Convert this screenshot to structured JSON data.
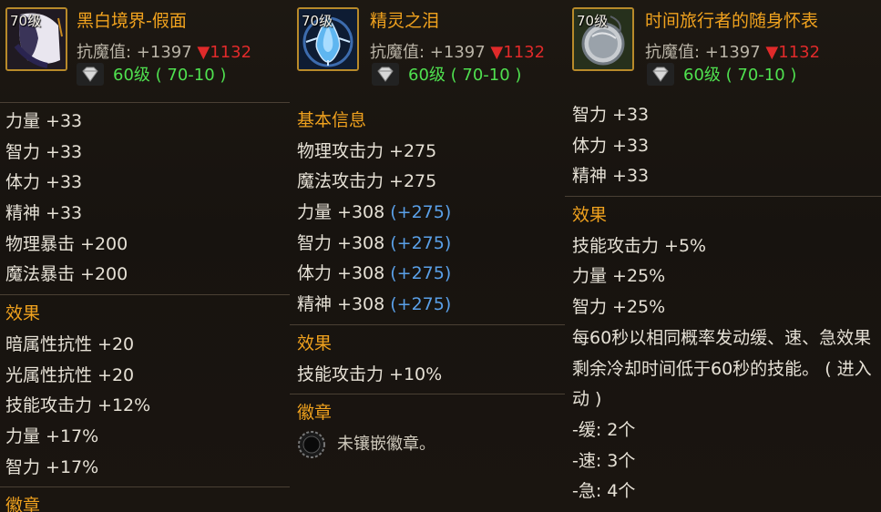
{
  "items": [
    {
      "level_badge": "70级",
      "name": "黑白境界-假面",
      "resist_label": "抗魔值: +1397 ",
      "resist_down": "▼1132",
      "requirement": "60级 ( 70-10 )",
      "stats": [
        "力量 +33",
        "智力 +33",
        "体力 +33",
        "精神 +33",
        "物理暴击 +200",
        "魔法暴击 +200"
      ],
      "effect_title": "效果",
      "effects": [
        "暗属性抗性 +20",
        "光属性抗性 +20",
        "技能攻击力 +12%",
        "力量 +17%",
        "智力 +17%"
      ],
      "cut_title": "徽章"
    },
    {
      "level_badge": "70级",
      "name": "精灵之泪",
      "resist_label": "抗魔值: +1397 ",
      "resist_down": "▼1132",
      "requirement": "60级 ( 70-10 )",
      "basic_title": "基本信息",
      "basic": [
        "物理攻击力 +275",
        "魔法攻击力 +275"
      ],
      "stats_main": [
        "力量 +308 ",
        "智力 +308 ",
        "体力 +308 ",
        "精神 +308 "
      ],
      "stats_bonus": [
        "(+275)",
        "(+275)",
        "(+275)",
        "(+275)"
      ],
      "effect_title": "效果",
      "effects": [
        "技能攻击力 +10%"
      ],
      "badge_title": "徽章",
      "badge_text": "未镶嵌徽章。"
    },
    {
      "level_badge": "70级",
      "name": "时间旅行者的随身怀表",
      "resist_label": "抗魔值: +1397 ",
      "resist_down": "▼1132",
      "requirement": "60级 ( 70-10 )",
      "stats": [
        "智力 +33",
        "体力 +33",
        "精神 +33"
      ],
      "effect_title": "效果",
      "effects": [
        "技能攻击力 +5%",
        "力量 +25%",
        "智力 +25%"
      ],
      "desc_lines": [
        "每60秒以相同概率发动缓、速、急效果",
        "剩余冷却时间低于60秒的技能。 ( 进入",
        "动 )"
      ],
      "counts": [
        "-缓: 2个",
        "-速: 3个",
        "-急: 4个"
      ]
    }
  ],
  "colors": {
    "title": "#f0a21e",
    "requirement": "#4fe04f",
    "down": "#e02a2a",
    "bonus": "#5aa0e8"
  }
}
